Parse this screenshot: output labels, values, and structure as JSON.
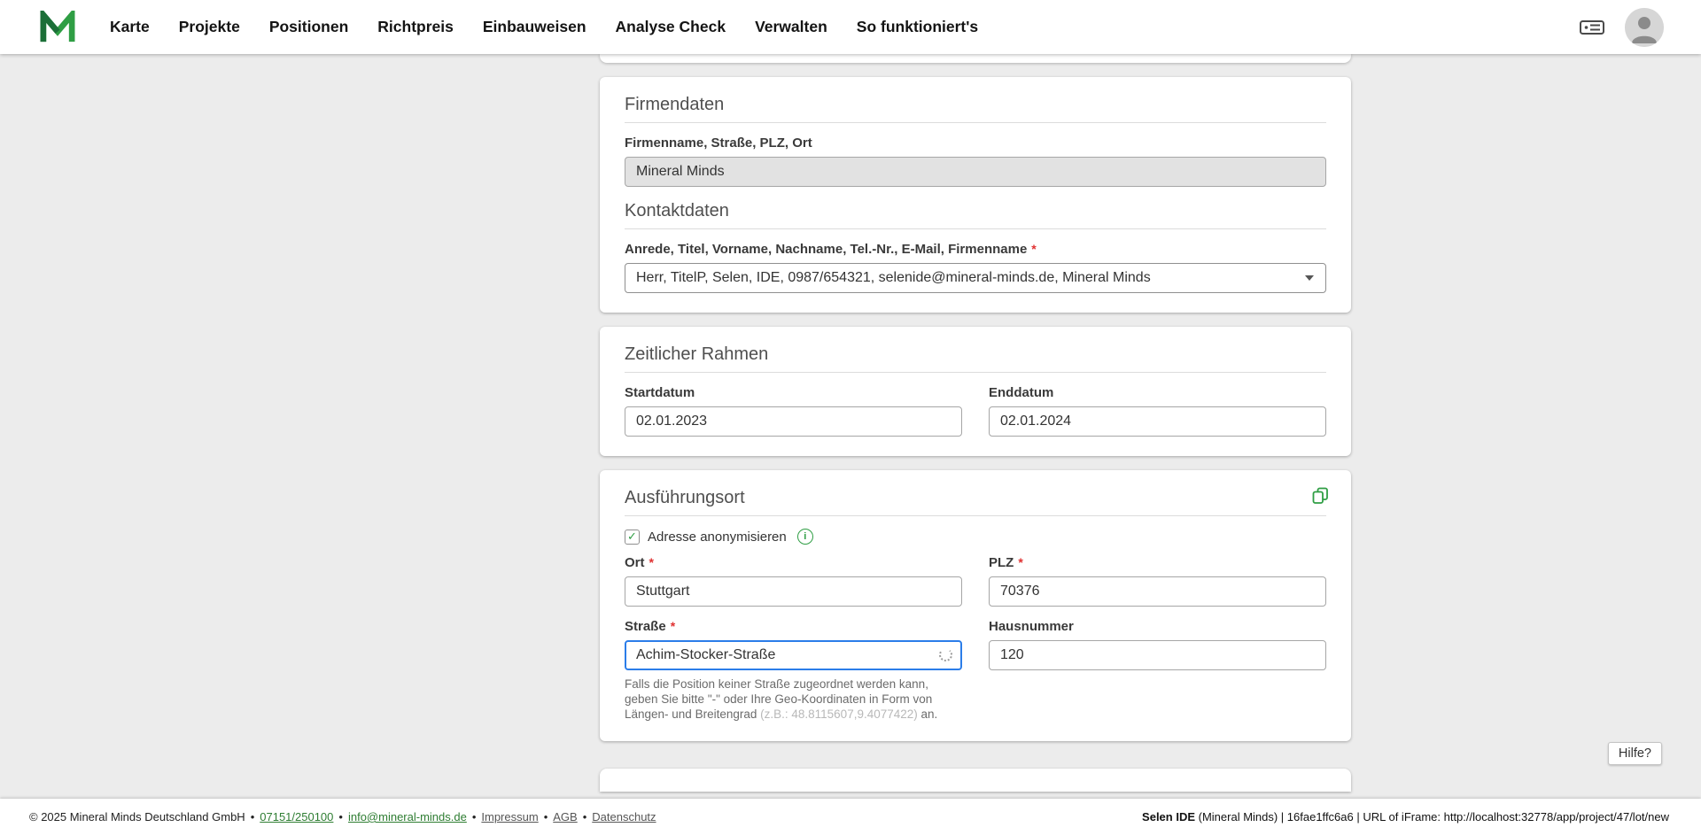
{
  "nav": {
    "items": [
      "Karte",
      "Projekte",
      "Positionen",
      "Richtpreis",
      "Einbauweisen",
      "Analyse Check",
      "Verwalten",
      "So funktioniert's"
    ]
  },
  "symbols": {
    "required": "*",
    "bullet": "•",
    "check": "✓",
    "info": "i"
  },
  "colors": {
    "accent_green": "#2f9e44",
    "focus_blue": "#2b7de9",
    "required_red": "#e03131"
  },
  "firmendaten": {
    "title": "Firmendaten",
    "company_label": "Firmenname, Straße, PLZ, Ort",
    "company_value": "Mineral Minds",
    "contact_title": "Kontaktdaten",
    "contact_label": "Anrede, Titel, Vorname, Nachname, Tel.-Nr., E-Mail, Firmenname",
    "contact_value": "Herr, TitelP, Selen, IDE, 0987/654321, selenide@mineral-minds.de, Mineral Minds"
  },
  "zeitlicher_rahmen": {
    "title": "Zeitlicher Rahmen",
    "start_label": "Startdatum",
    "start_value": "02.01.2023",
    "end_label": "Enddatum",
    "end_value": "02.01.2024"
  },
  "ausfuehrungsort": {
    "title": "Ausführungsort",
    "anonymize_label": "Adresse anonymisieren",
    "ort_label": "Ort",
    "ort_value": "Stuttgart",
    "plz_label": "PLZ",
    "plz_value": "70376",
    "strasse_label": "Straße",
    "strasse_value": "Achim-Stocker-Straße",
    "hausnummer_label": "Hausnummer",
    "hausnummer_value": "120",
    "help_text": "Falls die Position keiner Straße zugeordnet werden kann, geben Sie bitte \"-\" oder Ihre Geo-Koordinaten in Form von Längen- und Breitengrad ",
    "help_example": "(z.B.: 48.8115607,9.4077422)",
    "help_suffix": " an."
  },
  "help_button": {
    "label": "Hilfe?"
  },
  "footer": {
    "copyright": "© 2025 Mineral Minds Deutschland GmbH",
    "phone": "07151/250100",
    "email": "info@mineral-minds.de",
    "impressum": "Impressum",
    "agb": "AGB",
    "datenschutz": "Datenschutz",
    "right_bold": "Selen IDE",
    "right_text": " (Mineral Minds) | 16fae1ffc6a6 | URL of iFrame: http://localhost:32778/app/project/47/lot/new"
  }
}
